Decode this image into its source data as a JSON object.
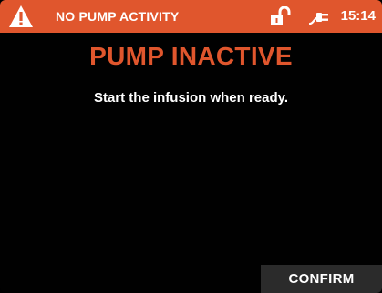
{
  "status_bar": {
    "title": "NO PUMP ACTIVITY",
    "time": "15:14",
    "background_color": "#e0562d",
    "icons": [
      "alert-triangle-icon",
      "unlocked-padlock-icon",
      "power-plug-icon"
    ]
  },
  "main": {
    "heading": "PUMP INACTIVE",
    "heading_color": "#e0562d",
    "message": "Start the infusion when ready."
  },
  "actions": {
    "confirm_label": "CONFIRM"
  }
}
